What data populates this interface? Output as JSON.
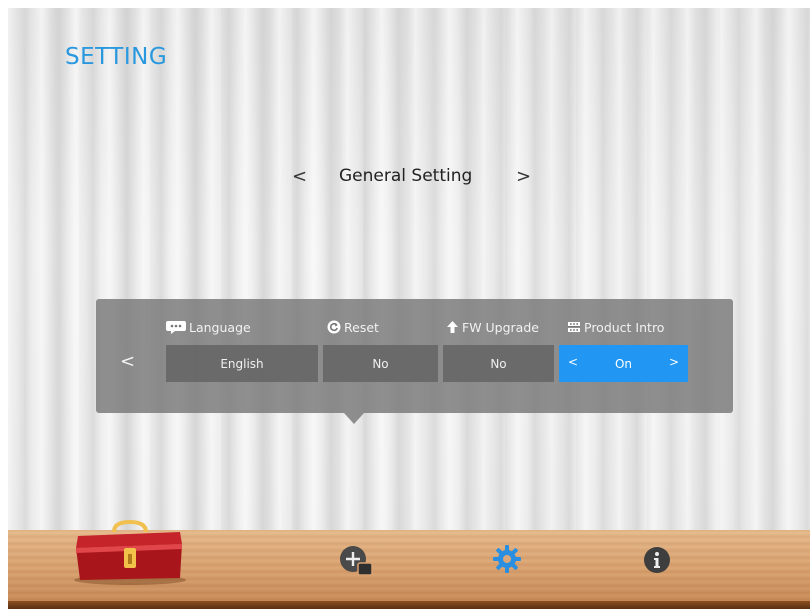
{
  "page": {
    "title": "SETTING"
  },
  "section": {
    "title": "General Setting",
    "prev": "<",
    "next": ">"
  },
  "panel": {
    "prev": "<",
    "columns": [
      {
        "label": "Language",
        "icon": "speech-bubble-icon",
        "value": "English"
      },
      {
        "label": "Reset",
        "icon": "reset-icon",
        "value": "No"
      },
      {
        "label": "FW Upgrade",
        "icon": "arrow-up-icon",
        "value": "No"
      },
      {
        "label": "Product Intro",
        "icon": "film-icon",
        "value": "On",
        "selected": true,
        "value_prev": "<",
        "value_next": ">"
      }
    ]
  },
  "dock": {
    "items": [
      {
        "icon": "toolbox-icon"
      },
      {
        "icon": "add-window-icon"
      },
      {
        "icon": "gear-icon",
        "active": true
      },
      {
        "icon": "info-icon"
      }
    ]
  },
  "colors": {
    "accent": "#2196f3",
    "title": "#2a98de"
  }
}
